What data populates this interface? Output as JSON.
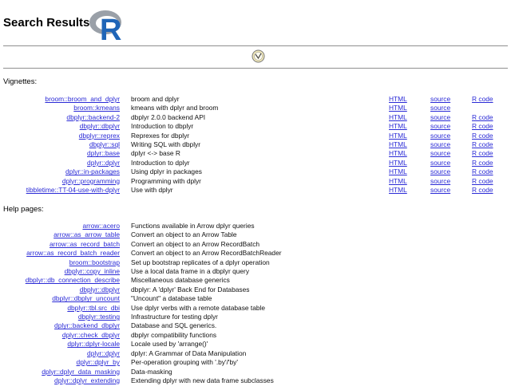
{
  "header": {
    "title": "Search Results",
    "logo_text": "R"
  },
  "vignettes": {
    "title": "Vignettes:",
    "rows": [
      {
        "name": "broom::broom_and_dplyr",
        "desc": "broom and dplyr",
        "html": "HTML",
        "source": "source",
        "rcode": "R code"
      },
      {
        "name": "broom::kmeans",
        "desc": "kmeans with dplyr and broom",
        "html": "HTML",
        "source": "source",
        "rcode": ""
      },
      {
        "name": "dbplyr::backend-2",
        "desc": "dbplyr 2.0.0 backend API",
        "html": "HTML",
        "source": "source",
        "rcode": "R code"
      },
      {
        "name": "dbplyr::dbplyr",
        "desc": "Introduction to dbplyr",
        "html": "HTML",
        "source": "source",
        "rcode": "R code"
      },
      {
        "name": "dbplyr::reprex",
        "desc": "Reprexes for dbplyr",
        "html": "HTML",
        "source": "source",
        "rcode": "R code"
      },
      {
        "name": "dbplyr::sql",
        "desc": "Writing SQL with dbplyr",
        "html": "HTML",
        "source": "source",
        "rcode": "R code"
      },
      {
        "name": "dplyr::base",
        "desc": "dplyr <-> base R",
        "html": "HTML",
        "source": "source",
        "rcode": "R code"
      },
      {
        "name": "dplyr::dplyr",
        "desc": "Introduction to dplyr",
        "html": "HTML",
        "source": "source",
        "rcode": "R code"
      },
      {
        "name": "dplyr::in-packages",
        "desc": "Using dplyr in packages",
        "html": "HTML",
        "source": "source",
        "rcode": "R code"
      },
      {
        "name": "dplyr::programming",
        "desc": "Programming with dplyr",
        "html": "HTML",
        "source": "source",
        "rcode": "R code"
      },
      {
        "name": "tibbletime::TT-04-use-with-dplyr",
        "desc": "Use with dplyr",
        "html": "HTML",
        "source": "source",
        "rcode": "R code"
      }
    ]
  },
  "help": {
    "title": "Help pages:",
    "rows": [
      {
        "name": "arrow::acero",
        "desc": "Functions available in Arrow dplyr queries"
      },
      {
        "name": "arrow::as_arrow_table",
        "desc": "Convert an object to an Arrow Table"
      },
      {
        "name": "arrow::as_record_batch",
        "desc": "Convert an object to an Arrow RecordBatch"
      },
      {
        "name": "arrow::as_record_batch_reader",
        "desc": "Convert an object to an Arrow RecordBatchReader"
      },
      {
        "name": "broom::bootstrap",
        "desc": "Set up bootstrap replicates of a dplyr operation"
      },
      {
        "name": "dbplyr::copy_inline",
        "desc": "Use a local data frame in a dbplyr query"
      },
      {
        "name": "dbplyr::db_connection_describe",
        "desc": "Miscellaneous database generics"
      },
      {
        "name": "dbplyr::dbplyr",
        "desc": "dbplyr: A 'dplyr' Back End for Databases"
      },
      {
        "name": "dbplyr::dbplyr_uncount",
        "desc": "\"Uncount\" a database table"
      },
      {
        "name": "dbplyr::tbl.src_dbi",
        "desc": "Use dplyr verbs with a remote database table"
      },
      {
        "name": "dbplyr::testing",
        "desc": "Infrastructure for testing dplyr"
      },
      {
        "name": "dplyr::backend_dbplyr",
        "desc": "Database and SQL generics."
      },
      {
        "name": "dplyr::check_dbplyr",
        "desc": "dbplyr compatibility functions"
      },
      {
        "name": "dplyr::dplyr-locale",
        "desc": "Locale used by 'arrange()'"
      },
      {
        "name": "dplyr::dplyr",
        "desc": "dplyr: A Grammar of Data Manipulation"
      },
      {
        "name": "dplyr::dplyr_by",
        "desc": "Per-operation grouping with '.by'/'by'"
      },
      {
        "name": "dplyr::dplyr_data_masking",
        "desc": "Data-masking"
      },
      {
        "name": "dplyr::dplyr_extending",
        "desc": "Extending dplyr with new data frame subclasses"
      }
    ]
  },
  "colors": {
    "link": "#2a2ad6",
    "logo_blue": "#1f65b7",
    "logo_gray": "#9aa0a8",
    "rule": "#8f8f8f"
  },
  "icons": {
    "home": "home-icon"
  }
}
